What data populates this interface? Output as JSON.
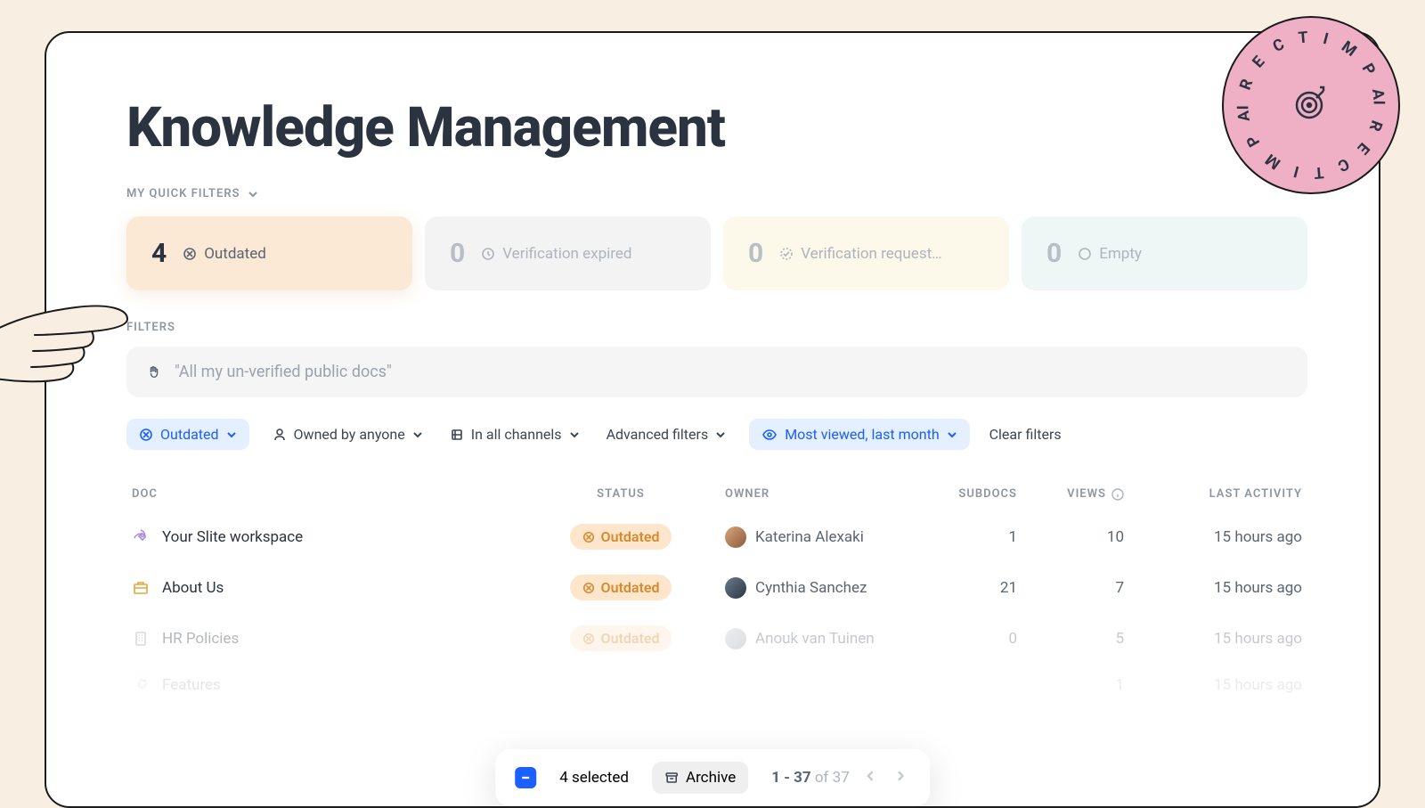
{
  "page": {
    "title": "Knowledge Management"
  },
  "stamp": {
    "text": "DIRECT IMPACT"
  },
  "quickFilters": {
    "label": "MY QUICK FILTERS",
    "cards": [
      {
        "count": "4",
        "label": "Outdated"
      },
      {
        "count": "0",
        "label": "Verification expired"
      },
      {
        "count": "0",
        "label": "Verification request…"
      },
      {
        "count": "0",
        "label": "Empty"
      }
    ]
  },
  "filters": {
    "label": "FILTERS",
    "placeholder": "\"All my un-verified public docs\"",
    "chips": {
      "outdated": "Outdated",
      "owned": "Owned by anyone",
      "channels": "In all channels",
      "advanced": "Advanced filters",
      "sort": "Most viewed, last month",
      "clear": "Clear filters"
    }
  },
  "table": {
    "headers": {
      "doc": "DOC",
      "status": "STATUS",
      "owner": "OWNER",
      "subdocs": "SUBDOCS",
      "views": "VIEWS",
      "last": "LAST ACTIVITY"
    },
    "rows": [
      {
        "doc": "Your Slite workspace",
        "status": "Outdated",
        "owner": "Katerina Alexaki",
        "subdocs": "1",
        "views": "10",
        "last": "15 hours ago"
      },
      {
        "doc": "About Us",
        "status": "Outdated",
        "owner": "Cynthia Sanchez",
        "subdocs": "21",
        "views": "7",
        "last": "15 hours ago"
      },
      {
        "doc": "HR Policies",
        "status": "Outdated",
        "owner": "Anouk van Tuinen",
        "subdocs": "0",
        "views": "5",
        "last": "15 hours ago"
      },
      {
        "doc": "Features",
        "status": "",
        "owner": "",
        "subdocs": "",
        "views": "1",
        "last": "15 hours ago"
      }
    ]
  },
  "floatingBar": {
    "selected": "4 selected",
    "archive": "Archive",
    "pager": {
      "range": "1 - 37",
      "of": "of 37"
    }
  }
}
